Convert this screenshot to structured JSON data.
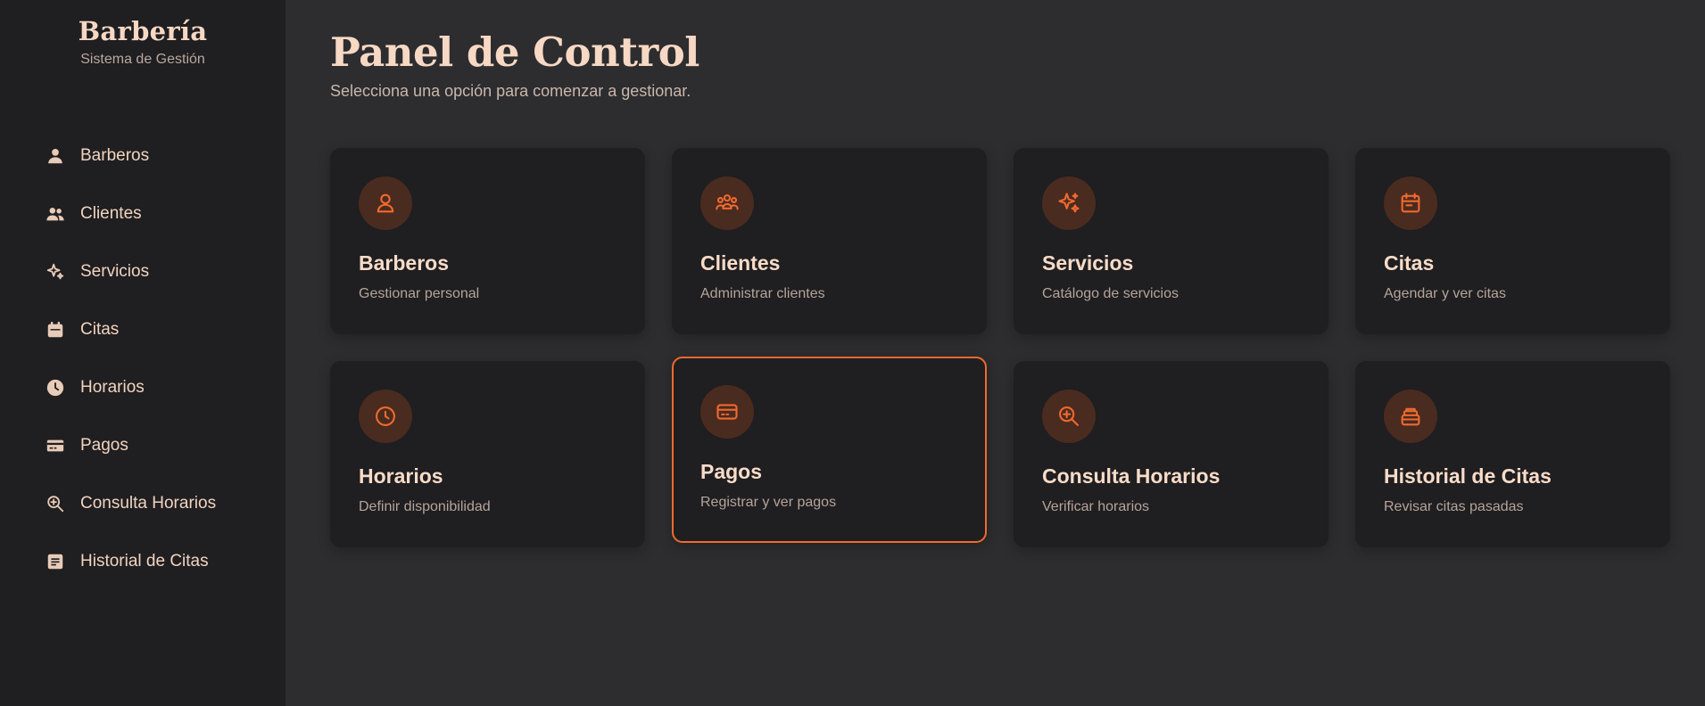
{
  "brand": {
    "title": "Barbería",
    "subtitle": "Sistema de Gestión"
  },
  "sidebar": {
    "items": [
      {
        "label": "Barberos",
        "icon": "user-icon"
      },
      {
        "label": "Clientes",
        "icon": "users-icon"
      },
      {
        "label": "Servicios",
        "icon": "sparkles-icon"
      },
      {
        "label": "Citas",
        "icon": "calendar-icon"
      },
      {
        "label": "Horarios",
        "icon": "clock-icon"
      },
      {
        "label": "Pagos",
        "icon": "credit-card-icon"
      },
      {
        "label": "Consulta Horarios",
        "icon": "zoom-in-icon"
      },
      {
        "label": "Historial de Citas",
        "icon": "document-icon"
      }
    ]
  },
  "header": {
    "title": "Panel de Control",
    "subtitle": "Selecciona una opción para comenzar a gestionar."
  },
  "cards": [
    {
      "title": "Barberos",
      "desc": "Gestionar personal",
      "icon": "user-icon"
    },
    {
      "title": "Clientes",
      "desc": "Administrar clientes",
      "icon": "users-icon"
    },
    {
      "title": "Servicios",
      "desc": "Catálogo de servicios",
      "icon": "sparkles-icon"
    },
    {
      "title": "Citas",
      "desc": "Agendar y ver citas",
      "icon": "calendar-icon"
    },
    {
      "title": "Horarios",
      "desc": "Definir disponibilidad",
      "icon": "clock-icon"
    },
    {
      "title": "Pagos",
      "desc": "Registrar y ver pagos",
      "icon": "credit-card-icon"
    },
    {
      "title": "Consulta Horarios",
      "desc": "Verificar horarios",
      "icon": "zoom-in-icon"
    },
    {
      "title": "Historial de Citas",
      "desc": "Revisar citas pasadas",
      "icon": "archive-icon"
    }
  ],
  "colors": {
    "accent": "#ef6a2e",
    "sidebar_bg": "#1f1e20",
    "main_bg": "#2d2d2f",
    "card_bg": "#1f1e20",
    "text_primary": "#f6d8c4",
    "icon_circle": "#4a2b20"
  }
}
